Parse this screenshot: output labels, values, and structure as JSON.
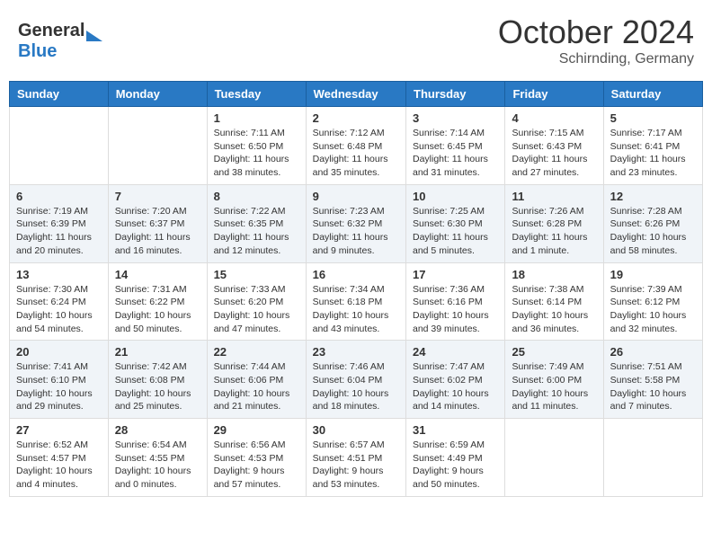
{
  "header": {
    "logo_general": "General",
    "logo_blue": "Blue",
    "month": "October 2024",
    "location": "Schirnding, Germany"
  },
  "days_of_week": [
    "Sunday",
    "Monday",
    "Tuesday",
    "Wednesday",
    "Thursday",
    "Friday",
    "Saturday"
  ],
  "weeks": [
    [
      {
        "num": "",
        "sunrise": "",
        "sunset": "",
        "daylight": ""
      },
      {
        "num": "",
        "sunrise": "",
        "sunset": "",
        "daylight": ""
      },
      {
        "num": "1",
        "sunrise": "Sunrise: 7:11 AM",
        "sunset": "Sunset: 6:50 PM",
        "daylight": "Daylight: 11 hours and 38 minutes."
      },
      {
        "num": "2",
        "sunrise": "Sunrise: 7:12 AM",
        "sunset": "Sunset: 6:48 PM",
        "daylight": "Daylight: 11 hours and 35 minutes."
      },
      {
        "num": "3",
        "sunrise": "Sunrise: 7:14 AM",
        "sunset": "Sunset: 6:45 PM",
        "daylight": "Daylight: 11 hours and 31 minutes."
      },
      {
        "num": "4",
        "sunrise": "Sunrise: 7:15 AM",
        "sunset": "Sunset: 6:43 PM",
        "daylight": "Daylight: 11 hours and 27 minutes."
      },
      {
        "num": "5",
        "sunrise": "Sunrise: 7:17 AM",
        "sunset": "Sunset: 6:41 PM",
        "daylight": "Daylight: 11 hours and 23 minutes."
      }
    ],
    [
      {
        "num": "6",
        "sunrise": "Sunrise: 7:19 AM",
        "sunset": "Sunset: 6:39 PM",
        "daylight": "Daylight: 11 hours and 20 minutes."
      },
      {
        "num": "7",
        "sunrise": "Sunrise: 7:20 AM",
        "sunset": "Sunset: 6:37 PM",
        "daylight": "Daylight: 11 hours and 16 minutes."
      },
      {
        "num": "8",
        "sunrise": "Sunrise: 7:22 AM",
        "sunset": "Sunset: 6:35 PM",
        "daylight": "Daylight: 11 hours and 12 minutes."
      },
      {
        "num": "9",
        "sunrise": "Sunrise: 7:23 AM",
        "sunset": "Sunset: 6:32 PM",
        "daylight": "Daylight: 11 hours and 9 minutes."
      },
      {
        "num": "10",
        "sunrise": "Sunrise: 7:25 AM",
        "sunset": "Sunset: 6:30 PM",
        "daylight": "Daylight: 11 hours and 5 minutes."
      },
      {
        "num": "11",
        "sunrise": "Sunrise: 7:26 AM",
        "sunset": "Sunset: 6:28 PM",
        "daylight": "Daylight: 11 hours and 1 minute."
      },
      {
        "num": "12",
        "sunrise": "Sunrise: 7:28 AM",
        "sunset": "Sunset: 6:26 PM",
        "daylight": "Daylight: 10 hours and 58 minutes."
      }
    ],
    [
      {
        "num": "13",
        "sunrise": "Sunrise: 7:30 AM",
        "sunset": "Sunset: 6:24 PM",
        "daylight": "Daylight: 10 hours and 54 minutes."
      },
      {
        "num": "14",
        "sunrise": "Sunrise: 7:31 AM",
        "sunset": "Sunset: 6:22 PM",
        "daylight": "Daylight: 10 hours and 50 minutes."
      },
      {
        "num": "15",
        "sunrise": "Sunrise: 7:33 AM",
        "sunset": "Sunset: 6:20 PM",
        "daylight": "Daylight: 10 hours and 47 minutes."
      },
      {
        "num": "16",
        "sunrise": "Sunrise: 7:34 AM",
        "sunset": "Sunset: 6:18 PM",
        "daylight": "Daylight: 10 hours and 43 minutes."
      },
      {
        "num": "17",
        "sunrise": "Sunrise: 7:36 AM",
        "sunset": "Sunset: 6:16 PM",
        "daylight": "Daylight: 10 hours and 39 minutes."
      },
      {
        "num": "18",
        "sunrise": "Sunrise: 7:38 AM",
        "sunset": "Sunset: 6:14 PM",
        "daylight": "Daylight: 10 hours and 36 minutes."
      },
      {
        "num": "19",
        "sunrise": "Sunrise: 7:39 AM",
        "sunset": "Sunset: 6:12 PM",
        "daylight": "Daylight: 10 hours and 32 minutes."
      }
    ],
    [
      {
        "num": "20",
        "sunrise": "Sunrise: 7:41 AM",
        "sunset": "Sunset: 6:10 PM",
        "daylight": "Daylight: 10 hours and 29 minutes."
      },
      {
        "num": "21",
        "sunrise": "Sunrise: 7:42 AM",
        "sunset": "Sunset: 6:08 PM",
        "daylight": "Daylight: 10 hours and 25 minutes."
      },
      {
        "num": "22",
        "sunrise": "Sunrise: 7:44 AM",
        "sunset": "Sunset: 6:06 PM",
        "daylight": "Daylight: 10 hours and 21 minutes."
      },
      {
        "num": "23",
        "sunrise": "Sunrise: 7:46 AM",
        "sunset": "Sunset: 6:04 PM",
        "daylight": "Daylight: 10 hours and 18 minutes."
      },
      {
        "num": "24",
        "sunrise": "Sunrise: 7:47 AM",
        "sunset": "Sunset: 6:02 PM",
        "daylight": "Daylight: 10 hours and 14 minutes."
      },
      {
        "num": "25",
        "sunrise": "Sunrise: 7:49 AM",
        "sunset": "Sunset: 6:00 PM",
        "daylight": "Daylight: 10 hours and 11 minutes."
      },
      {
        "num": "26",
        "sunrise": "Sunrise: 7:51 AM",
        "sunset": "Sunset: 5:58 PM",
        "daylight": "Daylight: 10 hours and 7 minutes."
      }
    ],
    [
      {
        "num": "27",
        "sunrise": "Sunrise: 6:52 AM",
        "sunset": "Sunset: 4:57 PM",
        "daylight": "Daylight: 10 hours and 4 minutes."
      },
      {
        "num": "28",
        "sunrise": "Sunrise: 6:54 AM",
        "sunset": "Sunset: 4:55 PM",
        "daylight": "Daylight: 10 hours and 0 minutes."
      },
      {
        "num": "29",
        "sunrise": "Sunrise: 6:56 AM",
        "sunset": "Sunset: 4:53 PM",
        "daylight": "Daylight: 9 hours and 57 minutes."
      },
      {
        "num": "30",
        "sunrise": "Sunrise: 6:57 AM",
        "sunset": "Sunset: 4:51 PM",
        "daylight": "Daylight: 9 hours and 53 minutes."
      },
      {
        "num": "31",
        "sunrise": "Sunrise: 6:59 AM",
        "sunset": "Sunset: 4:49 PM",
        "daylight": "Daylight: 9 hours and 50 minutes."
      },
      {
        "num": "",
        "sunrise": "",
        "sunset": "",
        "daylight": ""
      },
      {
        "num": "",
        "sunrise": "",
        "sunset": "",
        "daylight": ""
      }
    ]
  ]
}
